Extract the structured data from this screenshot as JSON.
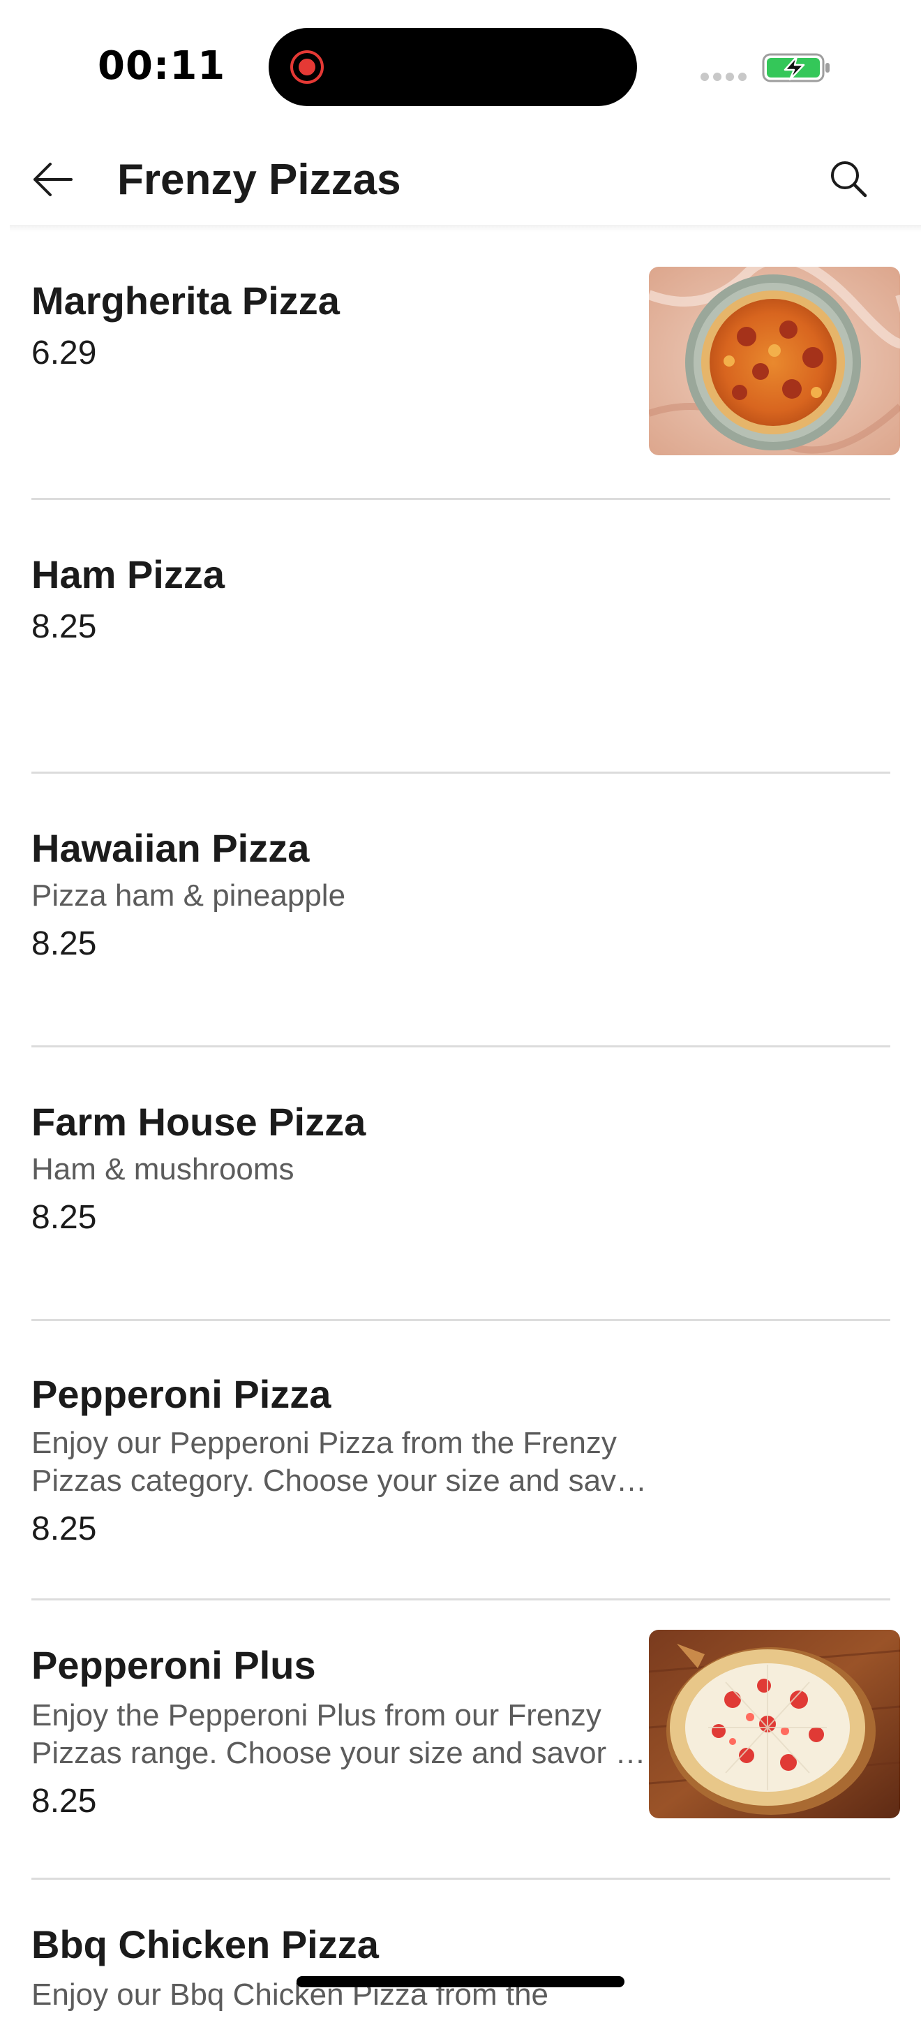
{
  "status_bar": {
    "time": "00:11",
    "recording_indicator_color": "#e53935",
    "battery_color": "#34c759",
    "battery_state": "charging"
  },
  "header": {
    "title": "Frenzy Pizzas",
    "back_icon": "arrow-left-icon",
    "search_icon": "search-icon"
  },
  "menu": {
    "items": [
      {
        "name": "Margherita Pizza",
        "description_lines": [],
        "price": "6.29",
        "has_image": true,
        "image_icon": "pizza-photo-margherita"
      },
      {
        "name": "Ham Pizza",
        "description_lines": [],
        "price": "8.25",
        "has_image": false
      },
      {
        "name": "Hawaiian Pizza",
        "description_lines": [
          "Pizza ham & pineapple"
        ],
        "price": "8.25",
        "has_image": false
      },
      {
        "name": "Farm House Pizza",
        "description_lines": [
          "Ham & mushrooms"
        ],
        "price": "8.25",
        "has_image": false
      },
      {
        "name": "Pepperoni Pizza",
        "description_lines": [
          "Enjoy our Pepperoni Pizza from the Frenzy",
          "Pizzas category. Choose your size and savo…"
        ],
        "price": "8.25",
        "has_image": false
      },
      {
        "name": "Pepperoni Plus",
        "description_lines": [
          "Enjoy the Pepperoni Plus from our Frenzy",
          "Pizzas range. Choose your size and savor a…"
        ],
        "price": "8.25",
        "has_image": true,
        "image_icon": "pizza-photo-pepperoni-plus"
      },
      {
        "name": "Bbq Chicken Pizza",
        "description_lines": [
          "Enjoy our Bbq Chicken Pizza from the"
        ],
        "price": "",
        "has_image": false
      }
    ]
  }
}
